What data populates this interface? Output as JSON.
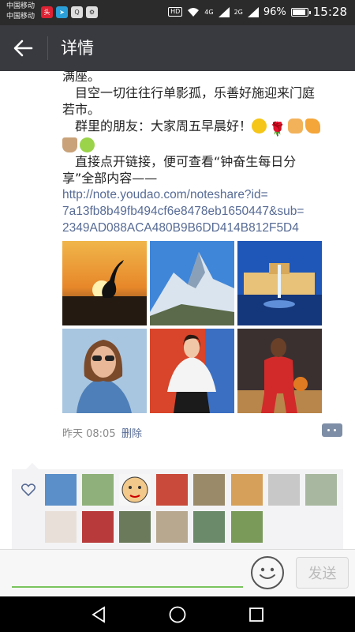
{
  "status_bar": {
    "carrier_1": "中国移动",
    "carrier_2": "中国移动",
    "hd_badge": "HD",
    "signal_1": "4G",
    "signal_2": "2G",
    "battery": "96%",
    "time": "15:28",
    "app_icons": [
      "toutiao-icon",
      "telegram-icon",
      "search-app-icon",
      "settings-app-icon"
    ]
  },
  "header": {
    "title": "详情",
    "back_icon": "back-arrow-icon"
  },
  "post": {
    "text_lines": [
      "满座。",
      "　目空一切往往行单影孤，乐善好施迎来门庭",
      "若市。",
      "　群里的朋友：大家周五早晨好！",
      "",
      "　直接点开链接，便可查看“钟奋生每日分",
      "享”全部内容——"
    ],
    "link_lines": [
      "http://note.youdao.com/noteshare?id=",
      "7a13fb8b49fb494cf6e8478eb1650447&sub=",
      "2349AD088ACA480B9B6DD414B812F5D4"
    ],
    "emojis": [
      "smile-emoji",
      "rose-emoji",
      "handshake-emoji",
      "pray-emoji",
      "coffee-emoji",
      "baby-emoji"
    ],
    "photos": [
      "sunset-crane",
      "snow-mountain",
      "palace-fountain",
      "woman-sunglasses",
      "woman-white-blouse",
      "basketball-player"
    ],
    "time": "昨天 08:05",
    "delete_label": "删除"
  },
  "likes": {
    "icon": "heart-icon",
    "avatar_count": 14
  },
  "input_bar": {
    "placeholder": "",
    "send_label": "发送"
  },
  "colors": {
    "title_bar": "#393a3f",
    "link": "#576b95",
    "input_underline": "#7bc45e"
  }
}
